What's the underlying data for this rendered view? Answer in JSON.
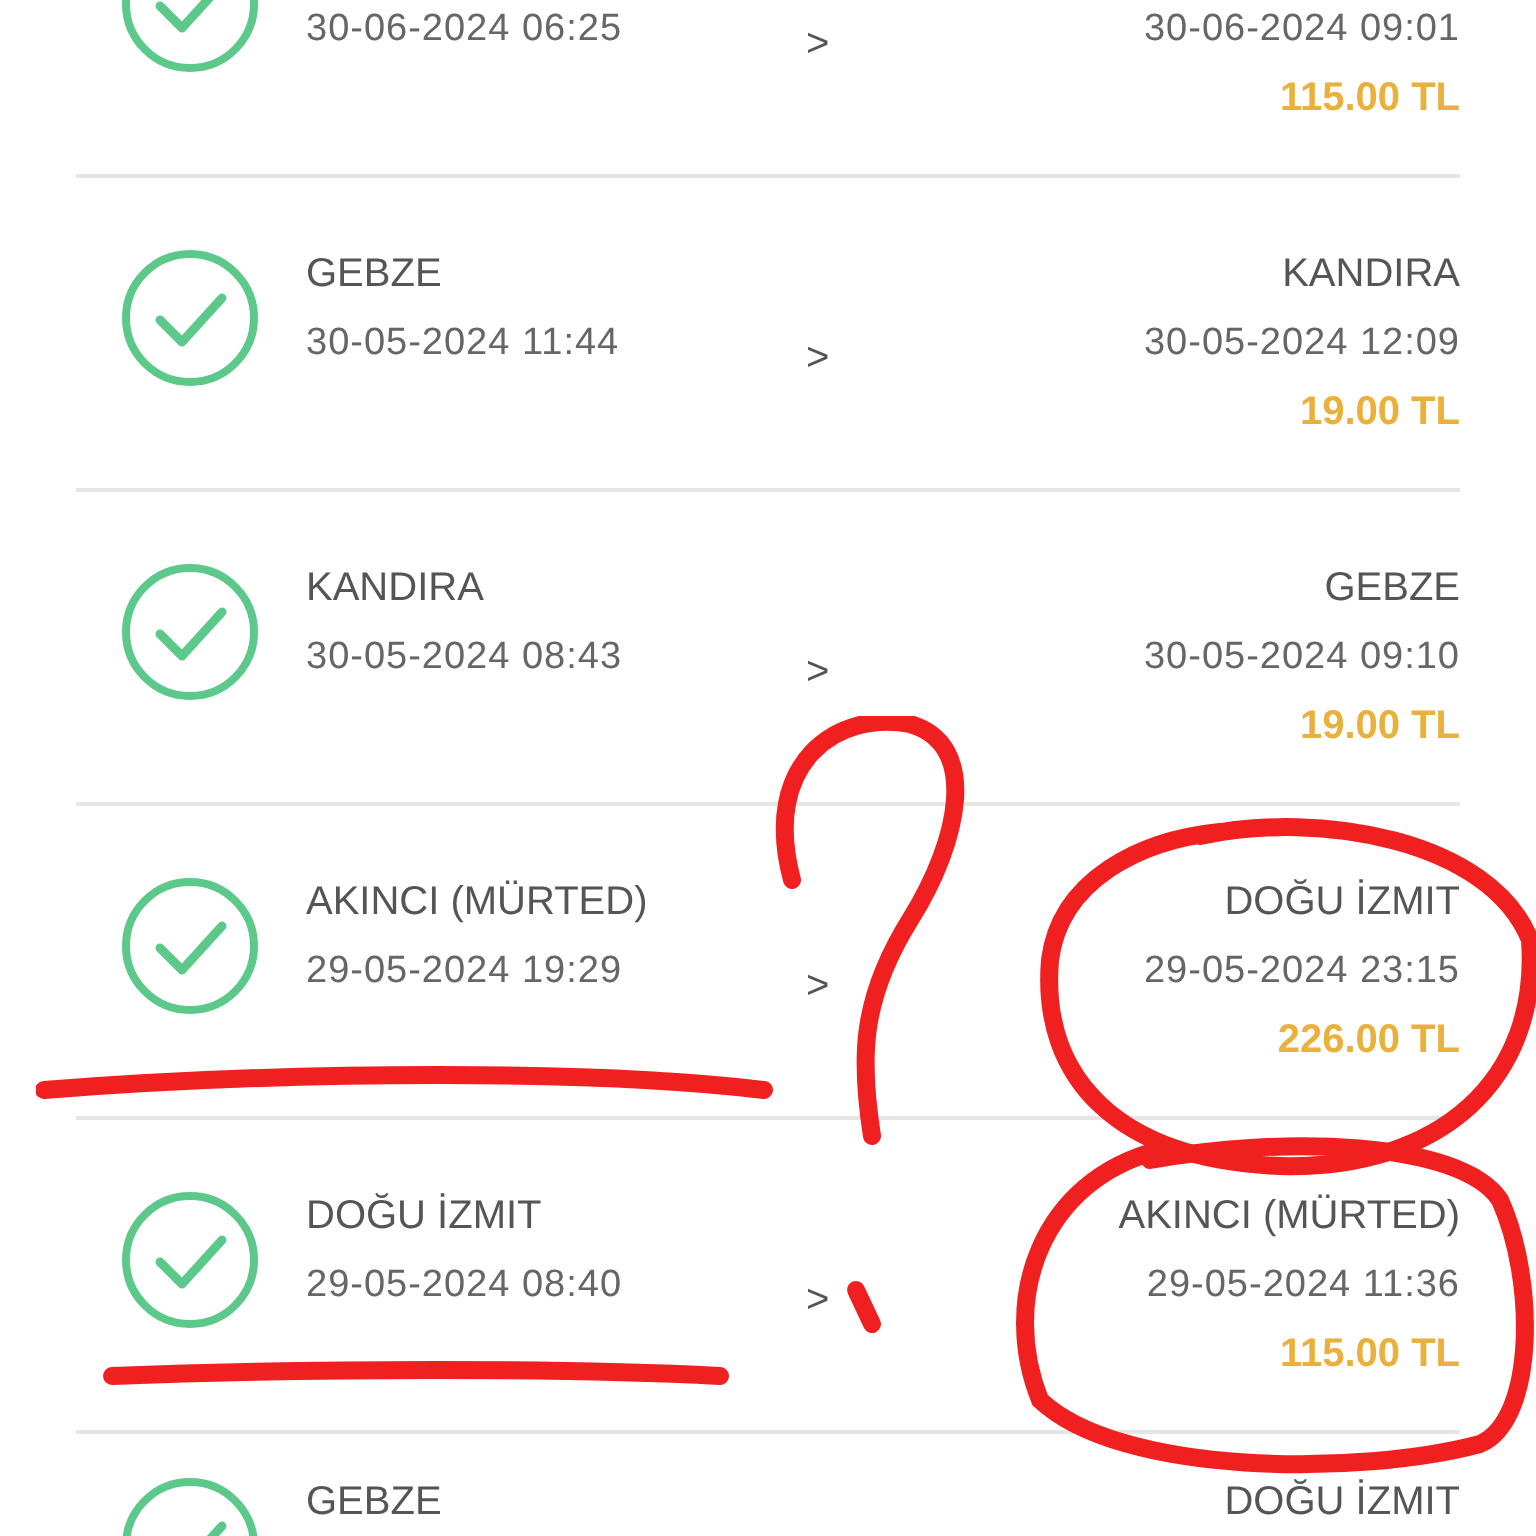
{
  "trips": [
    {
      "completed": true,
      "from": {
        "date": "30-06-2024 06:25"
      },
      "separator": ">",
      "to": {
        "date": "30-06-2024 09:01",
        "price": "115.00 TL"
      }
    },
    {
      "completed": true,
      "from": {
        "name": "GEBZE",
        "date": "30-05-2024 11:44"
      },
      "separator": ">",
      "to": {
        "name": "KANDIRA",
        "date": "30-05-2024 12:09",
        "price": "19.00 TL"
      }
    },
    {
      "completed": true,
      "from": {
        "name": "KANDIRA",
        "date": "30-05-2024 08:43"
      },
      "separator": ">",
      "to": {
        "name": "GEBZE",
        "date": "30-05-2024 09:10",
        "price": "19.00 TL"
      }
    },
    {
      "completed": true,
      "from": {
        "name": "AKINCI (MÜRTED)",
        "date": "29-05-2024 19:29"
      },
      "separator": ">",
      "to": {
        "name": "DOĞU İZMIT",
        "date": "29-05-2024 23:15",
        "price": "226.00 TL"
      }
    },
    {
      "completed": true,
      "from": {
        "name": "DOĞU İZMIT",
        "date": "29-05-2024 08:40"
      },
      "separator": ">",
      "to": {
        "name": "AKINCI (MÜRTED)",
        "date": "29-05-2024 11:36",
        "price": "115.00 TL"
      }
    },
    {
      "completed": true,
      "from": {
        "name": "GEBZE"
      },
      "to": {
        "name": "DOĞU İZMIT"
      }
    }
  ]
}
